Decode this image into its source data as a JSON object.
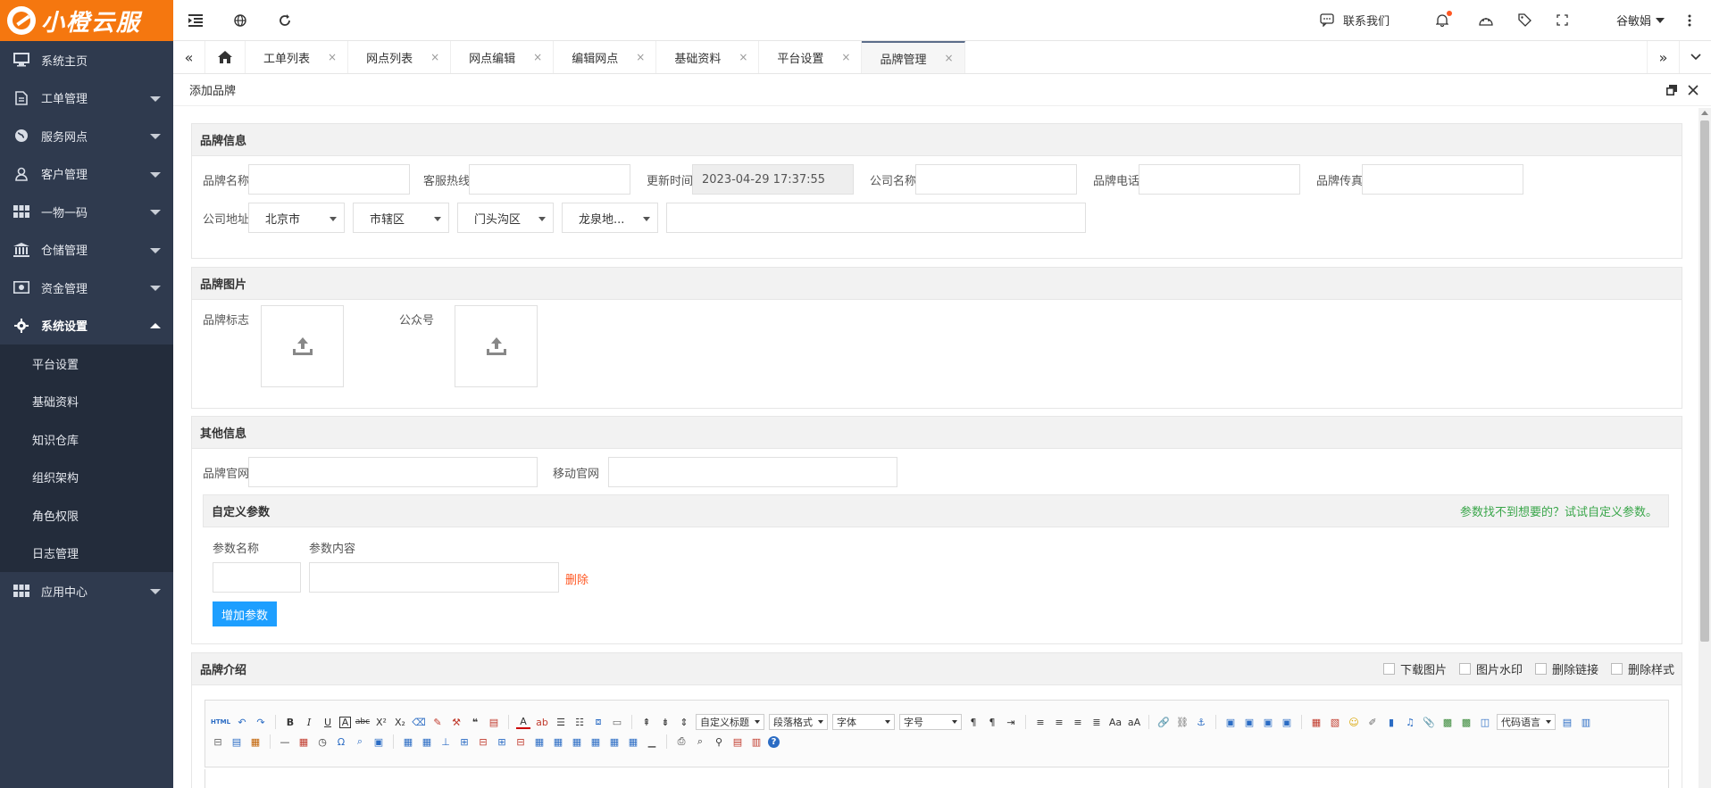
{
  "app": {
    "logo_text": "小橙云服"
  },
  "sidebar": {
    "items": [
      {
        "label": "系统主页"
      },
      {
        "label": "工单管理"
      },
      {
        "label": "服务网点"
      },
      {
        "label": "客户管理"
      },
      {
        "label": "一物一码"
      },
      {
        "label": "仓储管理"
      },
      {
        "label": "资金管理"
      },
      {
        "label": "系统设置"
      }
    ],
    "subitems": [
      {
        "label": "平台设置"
      },
      {
        "label": "基础资料"
      },
      {
        "label": "知识仓库"
      },
      {
        "label": "组织架构"
      },
      {
        "label": "角色权限"
      },
      {
        "label": "日志管理"
      }
    ],
    "last_item": {
      "label": "应用中心"
    }
  },
  "topbar": {
    "contact_label": "联系我们",
    "user_name": "谷敏娟"
  },
  "tabs": [
    {
      "label": "工单列表"
    },
    {
      "label": "网点列表"
    },
    {
      "label": "网点编辑"
    },
    {
      "label": "编辑网点"
    },
    {
      "label": "基础资料"
    },
    {
      "label": "平台设置"
    },
    {
      "label": "品牌管理"
    }
  ],
  "tab_close": "×",
  "page": {
    "title": "添加品牌"
  },
  "brand_info": {
    "title": "品牌信息",
    "name_label": "品牌名称",
    "hotline_label": "客服热线",
    "updated_label": "更新时间",
    "updated_value": "2023-04-29 17:37:55",
    "company_label": "公司名称",
    "phone_label": "品牌电话",
    "fax_label": "品牌传真",
    "address_label": "公司地址",
    "province": "北京市",
    "city": "市辖区",
    "district": "门头沟区",
    "street": "龙泉地..."
  },
  "brand_images": {
    "title": "品牌图片",
    "logo_label": "品牌标志",
    "wechat_label": "公众号"
  },
  "other_info": {
    "title": "其他信息",
    "website_label": "品牌官网",
    "mobile_label": "移动官网",
    "custom_title": "自定义参数",
    "custom_hint": "参数找不到想要的？试试自定义参数。",
    "param_name_label": "参数名称",
    "param_content_label": "参数内容",
    "delete_label": "删除",
    "add_param_label": "增加参数"
  },
  "intro": {
    "title": "品牌介绍",
    "opts": [
      "下载图片",
      "图片水印",
      "删除链接",
      "删除样式"
    ],
    "toolbar_selects": [
      "自定义标题",
      "段落格式",
      "字体",
      "字号",
      "代码语言"
    ]
  }
}
